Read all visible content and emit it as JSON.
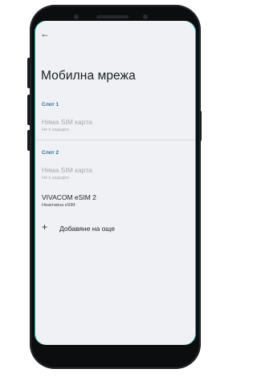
{
  "header": {
    "back_icon": "←",
    "title": "Мобилна мрежа"
  },
  "slot1": {
    "section": "Слот 1",
    "name": "Няма SIM карта",
    "status": "Не е зададен"
  },
  "slot2": {
    "section": "Слот 2",
    "name": "Няма SIM карта",
    "status": "Не е зададен"
  },
  "esim": {
    "name": "VIVACOM eSIM 2",
    "status": "Неактивна eSIM"
  },
  "add": {
    "icon": "+",
    "label": "Добавяне на още"
  },
  "colors": {
    "accent": "#2d6f9a",
    "background": "#eff1f4",
    "disabled": "#a3a8ae"
  }
}
